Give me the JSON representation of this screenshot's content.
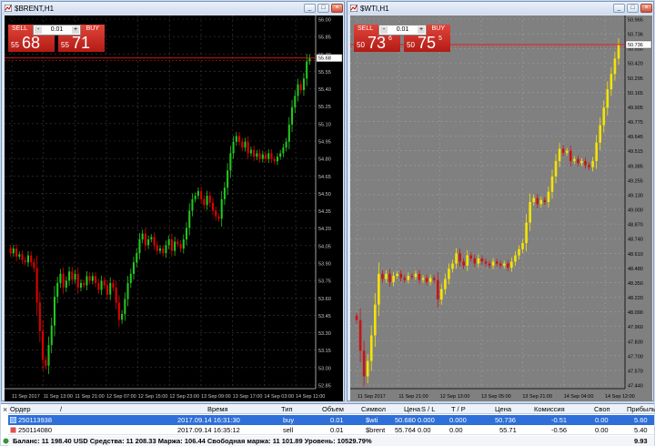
{
  "colors": {
    "left_bg": "#000000",
    "left_grid": "#3c3c3c",
    "left_bull": "#22c81e",
    "left_bear": "#e10000",
    "left_axis": "#c8c8c8",
    "right_bg": "#808080",
    "right_grid": "#9e9e9e",
    "right_bull": "#f5e400",
    "right_bear": "#c81414",
    "right_axis": "#000000",
    "level_line": "#e61a1a",
    "panel_red": "#c8261f",
    "selected_row": "#2e6fd9"
  },
  "windows": [
    {
      "title": "$BRENT,H1",
      "trade": {
        "sell_label": "SELL",
        "buy_label": "BUY",
        "lot": "0.01",
        "sell_prefix": "55",
        "sell_big": "68",
        "sell_sup": "",
        "buy_prefix": "55",
        "buy_big": "71",
        "buy_sup": ""
      },
      "y_ticks": [
        "56.00",
        "55.85",
        "55.70",
        "55.55",
        "55.40",
        "55.25",
        "55.10",
        "54.95",
        "54.80",
        "54.65",
        "54.50",
        "54.35",
        "54.20",
        "54.05",
        "53.90",
        "53.75",
        "53.60",
        "53.45",
        "53.30",
        "53.15",
        "53.00",
        "52.85"
      ],
      "x_ticks": [
        "11 Sep 2017",
        "11 Sep 13:00",
        "11 Sep 21:00",
        "12 Sep 07:00",
        "12 Sep 15:00",
        "12 Sep 23:00",
        "13 Sep 09:00",
        "13 Sep 17:00",
        "14 Sep 03:00",
        "14 Sep 11:00"
      ],
      "price_tag": "55.68",
      "y_range": [
        52.8,
        56.05
      ]
    },
    {
      "title": "$WTI,H1",
      "trade": {
        "sell_label": "SELL",
        "buy_label": "BUY",
        "lot": "0.01",
        "sell_prefix": "50",
        "sell_big": "73",
        "sell_sup": "6",
        "buy_prefix": "50",
        "buy_big": "75",
        "buy_sup": "5"
      },
      "y_ticks": [
        "50.965",
        "50.736",
        "50.550",
        "50.420",
        "50.295",
        "50.165",
        "49.905",
        "49.775",
        "49.645",
        "49.515",
        "49.385",
        "49.255",
        "49.130",
        "49.000",
        "48.870",
        "48.740",
        "48.610",
        "48.480",
        "48.350",
        "48.220",
        "48.090",
        "47.960",
        "47.830",
        "47.700",
        "47.570",
        "47.440"
      ],
      "x_ticks": [
        "11 Sep 2017",
        "11 Sep 21:00",
        "12 Sep 13:00",
        "13 Sep 05:00",
        "13 Sep 21:00",
        "14 Sep 04:00",
        "14 Sep 12:00"
      ],
      "price_tag": "50.736",
      "y_range": [
        47.38,
        51.02
      ]
    }
  ],
  "terminal": {
    "columns": [
      "Ордер",
      "/",
      "Время",
      "Тип",
      "Объем",
      "Символ",
      "Цена",
      "S / L",
      "T / P",
      "Цена",
      "Комиссия",
      "Своп",
      "Прибыль"
    ],
    "rows": [
      {
        "order": "250113938",
        "time": "2017.09.14 16:31:30",
        "type": "buy",
        "volume": "0.01",
        "symbol": "$wti",
        "price": "50.680",
        "sl": "0.000",
        "tp": "0.000",
        "cur_price": "50.736",
        "commission": "-0.51",
        "swap": "0.00",
        "profit": "5.60"
      },
      {
        "order": "250114080",
        "time": "2017.09.14 16:35:12",
        "type": "sell",
        "volume": "0.01",
        "symbol": "$brent",
        "price": "55.764",
        "sl": "0.00",
        "tp": "0.00",
        "cur_price": "55.71",
        "commission": "-0.56",
        "swap": "0.00",
        "profit": "5.40"
      }
    ],
    "balance_text": "Баланс: 11 198.40 USD  Средства: 11 208.33  Маржа: 106.44  Свободная маржа: 11 101.89  Уровень: 10529.79%",
    "total_profit": "9.93"
  },
  "chart_data": [
    {
      "type": "candlestick",
      "title": "$BRENT,H1",
      "xlabel": "",
      "ylabel": "",
      "ylim": [
        52.8,
        56.05
      ],
      "closes": [
        53.98,
        54.02,
        53.95,
        53.97,
        53.92,
        53.9,
        53.96,
        53.9,
        53.85,
        53.55,
        53.3,
        53.05,
        53.0,
        53.18,
        53.35,
        53.6,
        53.72,
        53.8,
        53.68,
        53.74,
        53.82,
        53.75,
        53.8,
        53.68,
        53.72,
        53.7,
        53.78,
        53.74,
        53.78,
        53.72,
        53.66,
        53.74,
        53.7,
        53.62,
        53.72,
        53.68,
        53.55,
        53.4,
        53.45,
        53.58,
        53.72,
        53.8,
        53.9,
        53.98,
        54.1,
        54.15,
        54.05,
        54.1,
        54.12,
        54.05,
        54.0,
        54.02,
        53.98,
        54.05,
        54.1,
        54.0,
        54.08,
        54.06,
        54.02,
        54.1,
        54.2,
        54.35,
        54.45,
        54.48,
        54.52,
        54.45,
        54.4,
        54.48,
        54.42,
        54.35,
        54.3,
        54.28,
        54.45,
        54.55,
        54.7,
        54.85,
        54.95,
        55.0,
        54.95,
        54.9,
        54.95,
        54.85,
        54.88,
        54.82,
        54.85,
        54.8,
        54.84,
        54.8,
        54.85,
        54.8,
        54.78,
        54.82,
        54.85,
        54.9,
        54.95,
        55.1,
        55.25,
        55.35,
        55.45,
        55.4,
        55.5,
        55.65,
        55.68
      ]
    },
    {
      "type": "candlestick",
      "title": "$WTI,H1",
      "xlabel": "",
      "ylabel": "",
      "ylim": [
        47.38,
        51.02
      ],
      "closes": [
        48.05,
        47.75,
        47.5,
        47.65,
        47.9,
        48.2,
        48.5,
        48.45,
        48.5,
        48.42,
        48.48,
        48.5,
        48.46,
        48.44,
        48.48,
        48.47,
        48.5,
        48.44,
        48.46,
        48.42,
        48.46,
        48.44,
        48.25,
        48.35,
        48.45,
        48.55,
        48.6,
        48.7,
        48.62,
        48.58,
        48.68,
        48.65,
        48.6,
        48.65,
        48.62,
        48.6,
        48.58,
        48.62,
        48.6,
        48.58,
        48.6,
        48.56,
        48.62,
        48.68,
        48.74,
        48.8,
        49.0,
        49.2,
        49.24,
        49.18,
        49.22,
        49.2,
        49.3,
        49.45,
        49.6,
        49.72,
        49.68,
        49.7,
        49.6,
        49.62,
        49.58,
        49.6,
        49.56,
        49.54,
        49.6,
        49.78,
        49.95,
        50.12,
        50.3,
        50.45,
        50.6,
        50.736
      ]
    }
  ]
}
